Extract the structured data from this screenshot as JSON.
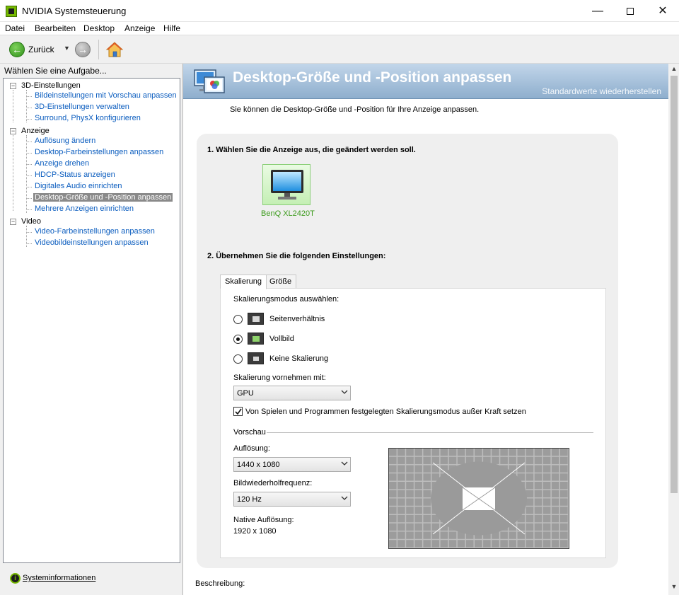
{
  "window": {
    "title": "NVIDIA Systemsteuerung",
    "buttons": {
      "minimize": "—",
      "close": "✕"
    }
  },
  "menu": [
    {
      "label": "Datei"
    },
    {
      "label": "Bearbeiten"
    },
    {
      "label": "Desktop"
    },
    {
      "label": "Anzeige"
    },
    {
      "label": "Hilfe"
    }
  ],
  "toolbar": {
    "back_label": "Zurück",
    "back_arrow": "←",
    "forward_arrow": "→",
    "dropdown": "▼"
  },
  "sidebar": {
    "header": "Wählen Sie eine Aufgabe...",
    "groups": [
      {
        "label": "3D-Einstellungen",
        "toggle": "−",
        "items": [
          {
            "label": "Bildeinstellungen mit Vorschau anpassen"
          },
          {
            "label": "3D-Einstellungen verwalten"
          },
          {
            "label": "Surround, PhysX konfigurieren"
          }
        ]
      },
      {
        "label": "Anzeige",
        "toggle": "−",
        "items": [
          {
            "label": "Auflösung ändern"
          },
          {
            "label": "Desktop-Farbeinstellungen anpassen"
          },
          {
            "label": "Anzeige drehen"
          },
          {
            "label": "HDCP-Status anzeigen"
          },
          {
            "label": "Digitales Audio einrichten"
          },
          {
            "label": "Desktop-Größe und -Position anpassen",
            "selected": true
          },
          {
            "label": "Mehrere Anzeigen einrichten"
          }
        ]
      },
      {
        "label": "Video",
        "toggle": "−",
        "items": [
          {
            "label": "Video-Farbeinstellungen anpassen"
          },
          {
            "label": "Videobildeinstellungen anpassen"
          }
        ]
      }
    ],
    "system_info": "Systeminformationen",
    "system_info_icon": "i"
  },
  "page": {
    "title": "Desktop-Größe und -Position anpassen",
    "restore_defaults": "Standardwerte wiederherstellen",
    "intro": "Sie können die Desktop-Größe und -Position für Ihre Anzeige anpassen.",
    "step1": "1. Wählen Sie die Anzeige aus, die geändert werden soll.",
    "display_name": "BenQ XL2420T",
    "step2": "2. Übernehmen Sie die folgenden Einstellungen:",
    "tabs": [
      {
        "label": "Skalierung",
        "active": true
      },
      {
        "label": "Größe",
        "active": false
      }
    ],
    "scaling_mode_label": "Skalierungsmodus auswählen:",
    "scaling_options": [
      {
        "label": "Seitenverhältnis",
        "checked": false,
        "icon": "aspect-ratio-icon"
      },
      {
        "label": "Vollbild",
        "checked": true,
        "icon": "fullscreen-icon"
      },
      {
        "label": "Keine Skalierung",
        "checked": false,
        "icon": "no-scaling-icon"
      }
    ],
    "perform_on_label": "Skalierung vornehmen mit:",
    "perform_on_value": "GPU",
    "override_checkbox": {
      "label": "Von Spielen und Programmen festgelegten Skalierungsmodus außer Kraft setzen",
      "checked": true
    },
    "preview_group": "Vorschau",
    "resolution_label": "Auflösung:",
    "resolution_value": "1440 x 1080",
    "refresh_label": "Bildwiederholfrequenz:",
    "refresh_value": "120 Hz",
    "native_label": "Native Auflösung:",
    "native_value": "1920 x 1080",
    "description_label": "Beschreibung:"
  },
  "scrollbar": {
    "up": "▲",
    "down": "▼"
  },
  "colors": {
    "nvidia_green": "#76b900",
    "link_blue": "#0b5dbf",
    "banner_top": "#c2d6ea",
    "banner_bottom": "#8eaecd",
    "selected_bg": "#8a8a8a"
  }
}
